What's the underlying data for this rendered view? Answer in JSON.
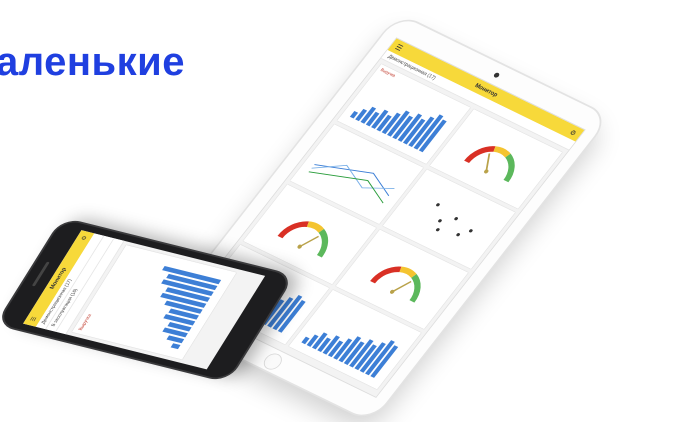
{
  "headline": {
    "text": "аленькие",
    "color": "#1f3fe0"
  },
  "colors": {
    "accent_yellow": "#f7d93a",
    "bar_blue": "#3d7fd6",
    "gauge_red": "#d93025",
    "gauge_green": "#5cb85c",
    "gauge_yellow": "#f4c430"
  },
  "tablet": {
    "title": "Монитор",
    "subbar": "Демонстрационная (17)",
    "cards": [
      {
        "title": "Выручка",
        "kind": "bars"
      },
      {
        "title": "",
        "kind": "gauge-needle"
      },
      {
        "title": "",
        "kind": "lines"
      },
      {
        "title": "",
        "kind": "scatter"
      },
      {
        "title": "",
        "kind": "gauge"
      },
      {
        "title": "",
        "kind": "gauge"
      },
      {
        "title": "",
        "kind": "bars"
      },
      {
        "title": "",
        "kind": "bars"
      }
    ]
  },
  "phone": {
    "title": "Монитор",
    "rows": [
      {
        "label": "Демонстрационная (17)"
      },
      {
        "label": "В эксплуатации (16)"
      },
      {
        "label": ""
      }
    ],
    "card_title": "Выручка",
    "legend": "Выручка"
  }
}
